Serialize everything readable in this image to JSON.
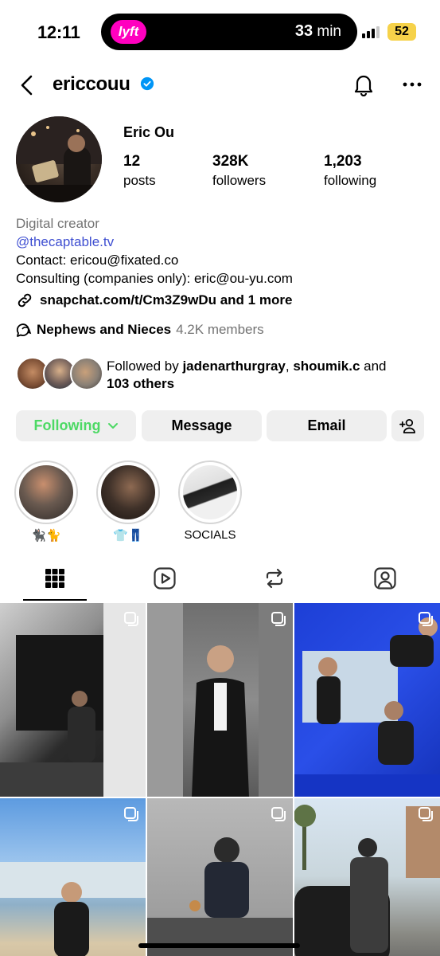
{
  "status_bar": {
    "time": "12:11",
    "live_activity": {
      "app_badge": "lyft",
      "eta_value": "33",
      "eta_unit": "min"
    },
    "battery": "52"
  },
  "header": {
    "username": "ericcouu",
    "verified": true
  },
  "profile": {
    "display_name": "Eric Ou",
    "stats": [
      {
        "value": "12",
        "label": "posts"
      },
      {
        "value": "328K",
        "label": "followers"
      },
      {
        "value": "1,203",
        "label": "following"
      }
    ],
    "bio": {
      "category": "Digital creator",
      "handle": "@thecaptable.tv",
      "contact": "Contact: ericou@fixated.co",
      "consulting": "Consulting (companies only): eric@ou-yu.com",
      "link": "snapchat.com/t/Cm3Z9wDu and 1 more"
    },
    "channel": {
      "name": "Nephews and Nieces",
      "members": "4.2K members"
    },
    "followed_by": {
      "prefix": "Followed by ",
      "user1": "jadenarthurgray",
      "sep": ", ",
      "user2": "shoumik.c",
      "and": " and",
      "others": "103 others"
    }
  },
  "actions": {
    "following_label": "Following",
    "message_label": "Message",
    "email_label": "Email"
  },
  "highlights": [
    {
      "label": "🐈‍⬛🐈"
    },
    {
      "label": "👕👖"
    },
    {
      "label": "SOCIALS"
    }
  ],
  "tabs": [
    "grid-icon",
    "reels-icon",
    "reposts-icon",
    "tagged-icon"
  ],
  "colors": {
    "following_green": "#4cd964",
    "link_blue": "#3f4fd1",
    "verified_blue": "#0095f6",
    "lyft_pink": "#ff00bf",
    "battery_yellow": "#f6d24a"
  }
}
